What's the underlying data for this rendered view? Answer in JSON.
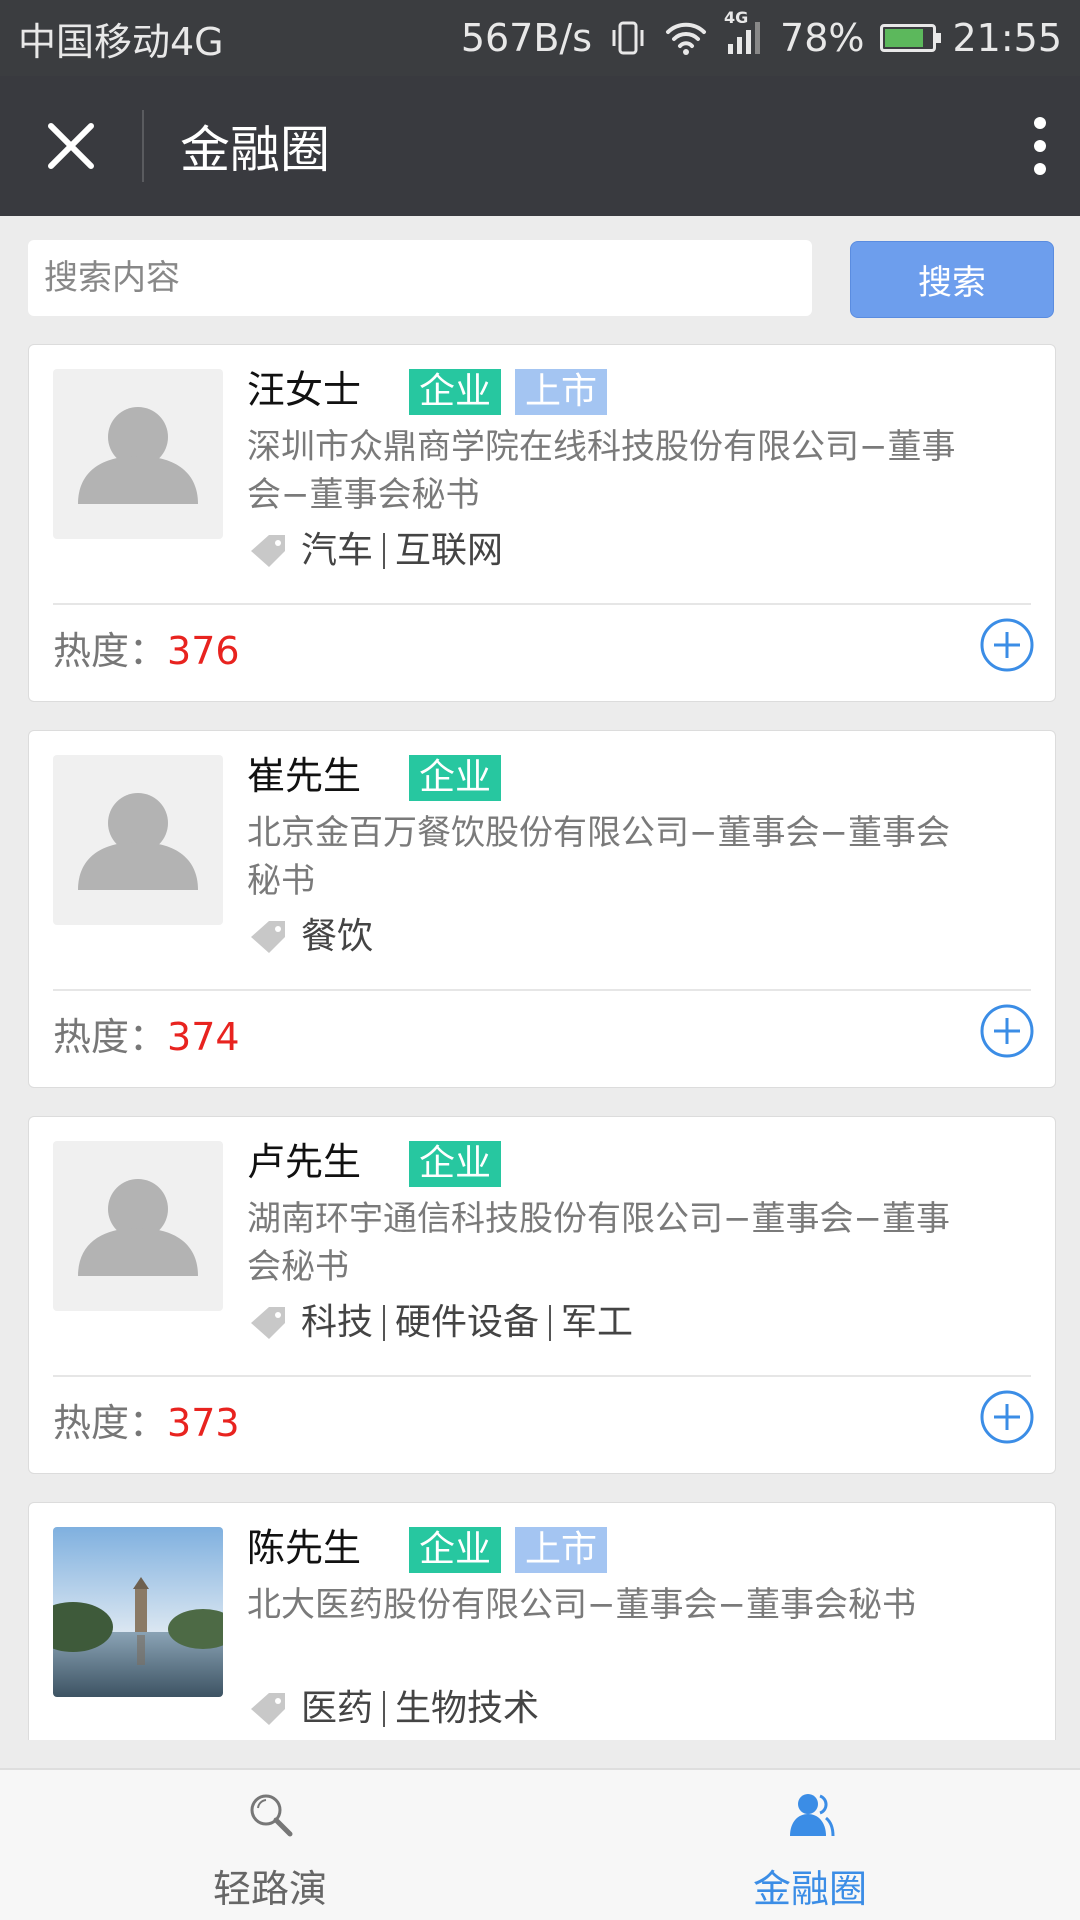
{
  "status_bar": {
    "carrier": "中国移动4G",
    "speed": "567B/s",
    "network": "4G",
    "battery": "78%",
    "time": "21:55"
  },
  "nav": {
    "title": "金融圈"
  },
  "search": {
    "placeholder": "搜索内容",
    "button_label": "搜索"
  },
  "heat_label": "热度：",
  "cards": [
    {
      "name": "汪女士",
      "badges": [
        "企业",
        "上市"
      ],
      "company": "深圳市众鼎商学院在线科技股份有限公司−董事会−董事会秘书",
      "tags": [
        "汽车",
        "互联网"
      ],
      "heat": "376",
      "avatar": "placeholder"
    },
    {
      "name": "崔先生",
      "badges": [
        "企业"
      ],
      "company": "北京金百万餐饮股份有限公司−董事会−董事会秘书",
      "tags": [
        "餐饮"
      ],
      "heat": "374",
      "avatar": "placeholder"
    },
    {
      "name": "卢先生",
      "badges": [
        "企业"
      ],
      "company": "湖南环宇通信科技股份有限公司−董事会−董事会秘书",
      "tags": [
        "科技",
        "硬件设备",
        "军工"
      ],
      "heat": "373",
      "avatar": "placeholder"
    },
    {
      "name": "陈先生",
      "badges": [
        "企业",
        "上市"
      ],
      "company": "北大医药股份有限公司−董事会−董事会秘书",
      "tags": [
        "医药",
        "生物技术"
      ],
      "heat": "",
      "avatar": "photo"
    }
  ],
  "tabbar": {
    "items": [
      {
        "label": "轻路演",
        "icon": "magnifier-icon",
        "active": false
      },
      {
        "label": "金融圈",
        "icon": "people-icon",
        "active": true
      }
    ]
  },
  "colors": {
    "enterprise_badge": "#27c7a0",
    "listed_badge": "#a4c5f2",
    "heat_value": "#e8231f",
    "accent_blue": "#3b8de6",
    "search_button": "#6d9eed"
  }
}
